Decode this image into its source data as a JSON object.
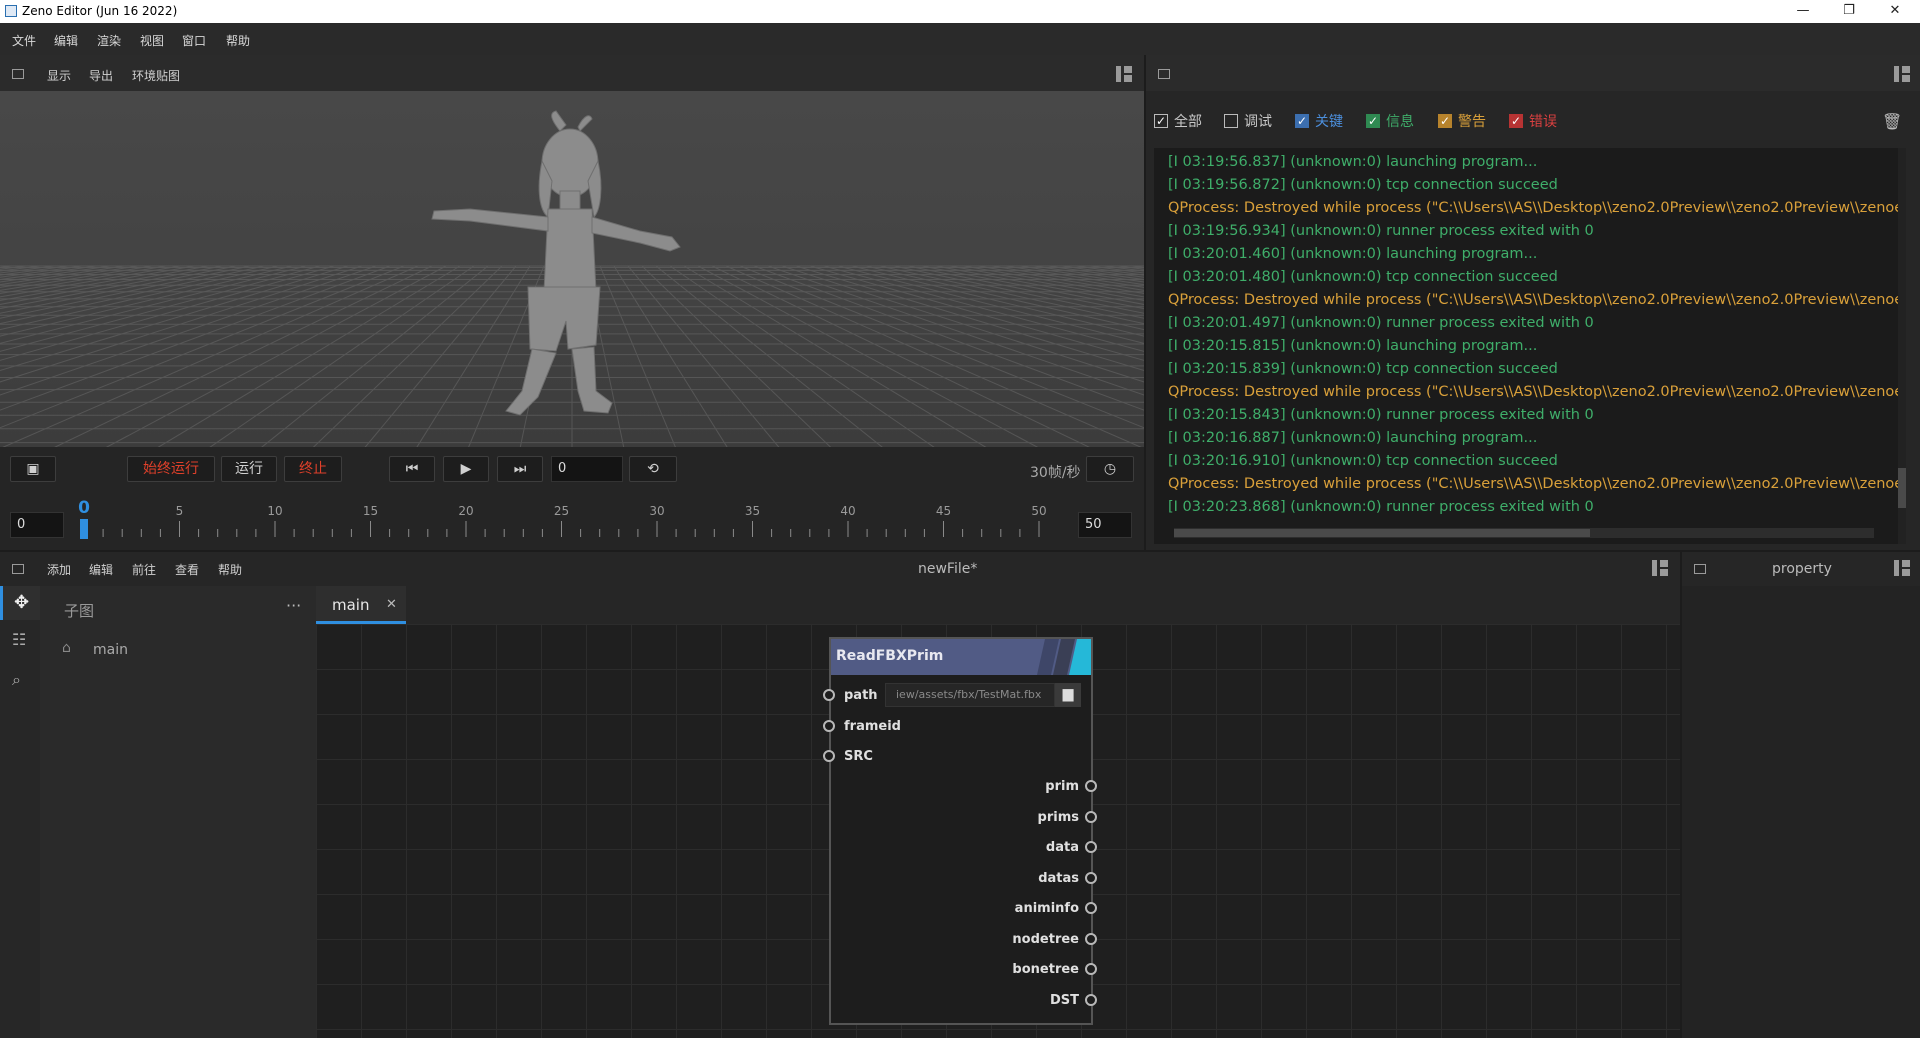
{
  "window": {
    "title": "Zeno Editor (Jun 16 2022)",
    "minimize": "—",
    "maximize": "❐",
    "close": "✕"
  },
  "menubar": [
    "文件",
    "编辑",
    "渲染",
    "视图",
    "窗口",
    "帮助"
  ],
  "viewport_toolbar": [
    "显示",
    "导出",
    "环境贴图"
  ],
  "transport": {
    "always_run": "始终运行",
    "run": "运行",
    "stop": "终止",
    "frame_value": "0",
    "fps": "30帧/秒",
    "start_frame": "0",
    "end_frame": "50",
    "current_frame_label": "0",
    "tick_labels": [
      "0",
      "5",
      "10",
      "15",
      "20",
      "25",
      "30",
      "35",
      "40",
      "45",
      "50"
    ],
    "current_frame": 0
  },
  "log_filters": [
    {
      "label": "全部",
      "checked": true,
      "color": "#d0d0d0"
    },
    {
      "label": "调试",
      "checked": false,
      "color": "#d0d0d0"
    },
    {
      "label": "关键",
      "checked": true,
      "color": "#4c8fdc"
    },
    {
      "label": "信息",
      "checked": true,
      "color": "#3fae6a"
    },
    {
      "label": "警告",
      "checked": true,
      "color": "#d9a03a"
    },
    {
      "label": "错误",
      "checked": true,
      "color": "#d94040"
    }
  ],
  "log_lines": [
    {
      "text": "[I 03:19:56.837] (unknown:0) launching program...",
      "level": "info"
    },
    {
      "text": "[I 03:19:56.872] (unknown:0) tcp connection succeed",
      "level": "info"
    },
    {
      "text": "QProcess: Destroyed while process (\"C:\\\\Users\\\\AS\\\\Desktop\\\\zeno2.0Preview\\\\zeno2.0Preview\\\\zenoe",
      "level": "warn"
    },
    {
      "text": "[I 03:19:56.934] (unknown:0) runner process exited with 0",
      "level": "info"
    },
    {
      "text": "[I 03:20:01.460] (unknown:0) launching program...",
      "level": "info"
    },
    {
      "text": "[I 03:20:01.480] (unknown:0) tcp connection succeed",
      "level": "info"
    },
    {
      "text": "QProcess: Destroyed while process (\"C:\\\\Users\\\\AS\\\\Desktop\\\\zeno2.0Preview\\\\zeno2.0Preview\\\\zenoe",
      "level": "warn"
    },
    {
      "text": "[I 03:20:01.497] (unknown:0) runner process exited with 0",
      "level": "info"
    },
    {
      "text": "[I 03:20:15.815] (unknown:0) launching program...",
      "level": "info"
    },
    {
      "text": "[I 03:20:15.839] (unknown:0) tcp connection succeed",
      "level": "info"
    },
    {
      "text": "QProcess: Destroyed while process (\"C:\\\\Users\\\\AS\\\\Desktop\\\\zeno2.0Preview\\\\zeno2.0Preview\\\\zenoe",
      "level": "warn"
    },
    {
      "text": "[I 03:20:15.843] (unknown:0) runner process exited with 0",
      "level": "info"
    },
    {
      "text": "[I 03:20:16.887] (unknown:0) launching program...",
      "level": "info"
    },
    {
      "text": "[I 03:20:16.910] (unknown:0) tcp connection succeed",
      "level": "info"
    },
    {
      "text": "QProcess: Destroyed while process (\"C:\\\\Users\\\\AS\\\\Desktop\\\\zeno2.0Preview\\\\zeno2.0Preview\\\\zenoe",
      "level": "warn"
    },
    {
      "text": "[I 03:20:23.868] (unknown:0) runner process exited with 0",
      "level": "info"
    }
  ],
  "colors": {
    "info": "#3fae6a",
    "warn": "#d9a03a",
    "accent": "#2f8fe0",
    "red": "#e0402a",
    "node_header": "#515b85"
  },
  "editor_menu": [
    "添加",
    "编辑",
    "前往",
    "查看",
    "帮助"
  ],
  "editor_title": "newFile*",
  "subgraph_panel": {
    "title": "子图",
    "more": "···",
    "items": [
      "main"
    ]
  },
  "tabs": [
    {
      "label": "main",
      "close": "✕"
    }
  ],
  "node": {
    "title": "ReadFBXPrim",
    "path_value": "iew/assets/fbx/TestMat.fbx",
    "inputs": [
      "path",
      "frameid",
      "SRC"
    ],
    "outputs": [
      "prim",
      "prims",
      "data",
      "datas",
      "animinfo",
      "nodetree",
      "bonetree",
      "DST"
    ]
  },
  "property_panel": {
    "title": "property"
  },
  "icons": {
    "dock": "dock-icon",
    "split": "split-view-icon",
    "trash": "trash-icon",
    "node_editor": "node-editor-icon",
    "tree": "tree-icon",
    "search": "search-icon",
    "screenshot": "screenshot-icon",
    "prev": "skip-back-icon",
    "play": "play-icon",
    "next": "skip-forward-icon",
    "loop": "loop-icon",
    "clock": "clock-icon",
    "folder": "folder-icon"
  }
}
